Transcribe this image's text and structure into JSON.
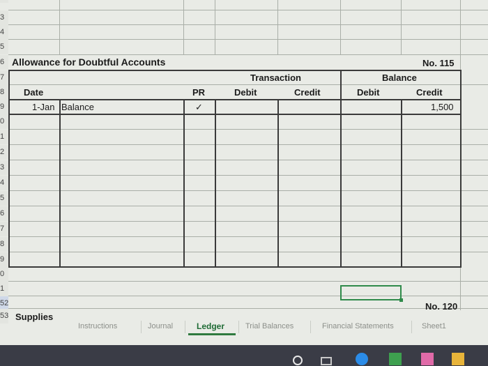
{
  "row_numbers": [
    "2",
    "3",
    "4",
    "5",
    "6",
    "7",
    "8",
    "9",
    "0",
    "1",
    "2",
    "3",
    "4",
    "5",
    "6",
    "7",
    "8",
    "9",
    "0",
    "1",
    "52",
    "53"
  ],
  "ledger": {
    "account_title": "Allowance for Doubtful Accounts",
    "account_number": "No. 115",
    "transaction_header": "Transaction",
    "balance_header": "Balance",
    "col_date": "Date",
    "col_pr": "PR",
    "col_debit": "Debit",
    "col_credit": "Credit",
    "col_bal_debit": "Debit",
    "col_bal_credit": "Credit",
    "entry": {
      "date": "1-Jan",
      "description": "Balance",
      "pr": "✓",
      "balance_credit": "1,500"
    }
  },
  "next_account": {
    "title": "Supplies",
    "number": "No. 120"
  },
  "tabs": [
    "Instructions",
    "Journal",
    "Ledger",
    "Trial Balances",
    "Financial Statements",
    "Sheet1"
  ],
  "active_tab": "Ledger",
  "colors": {
    "grid": "#a9aea7",
    "border": "#3a3a3a",
    "active_tab": "#1f6b35",
    "selection": "#2f8a4a"
  },
  "taskbar_icons": [
    "search-icon",
    "task-view-icon",
    "edge-icon",
    "store-icon",
    "mail-icon",
    "shopping-icon"
  ]
}
